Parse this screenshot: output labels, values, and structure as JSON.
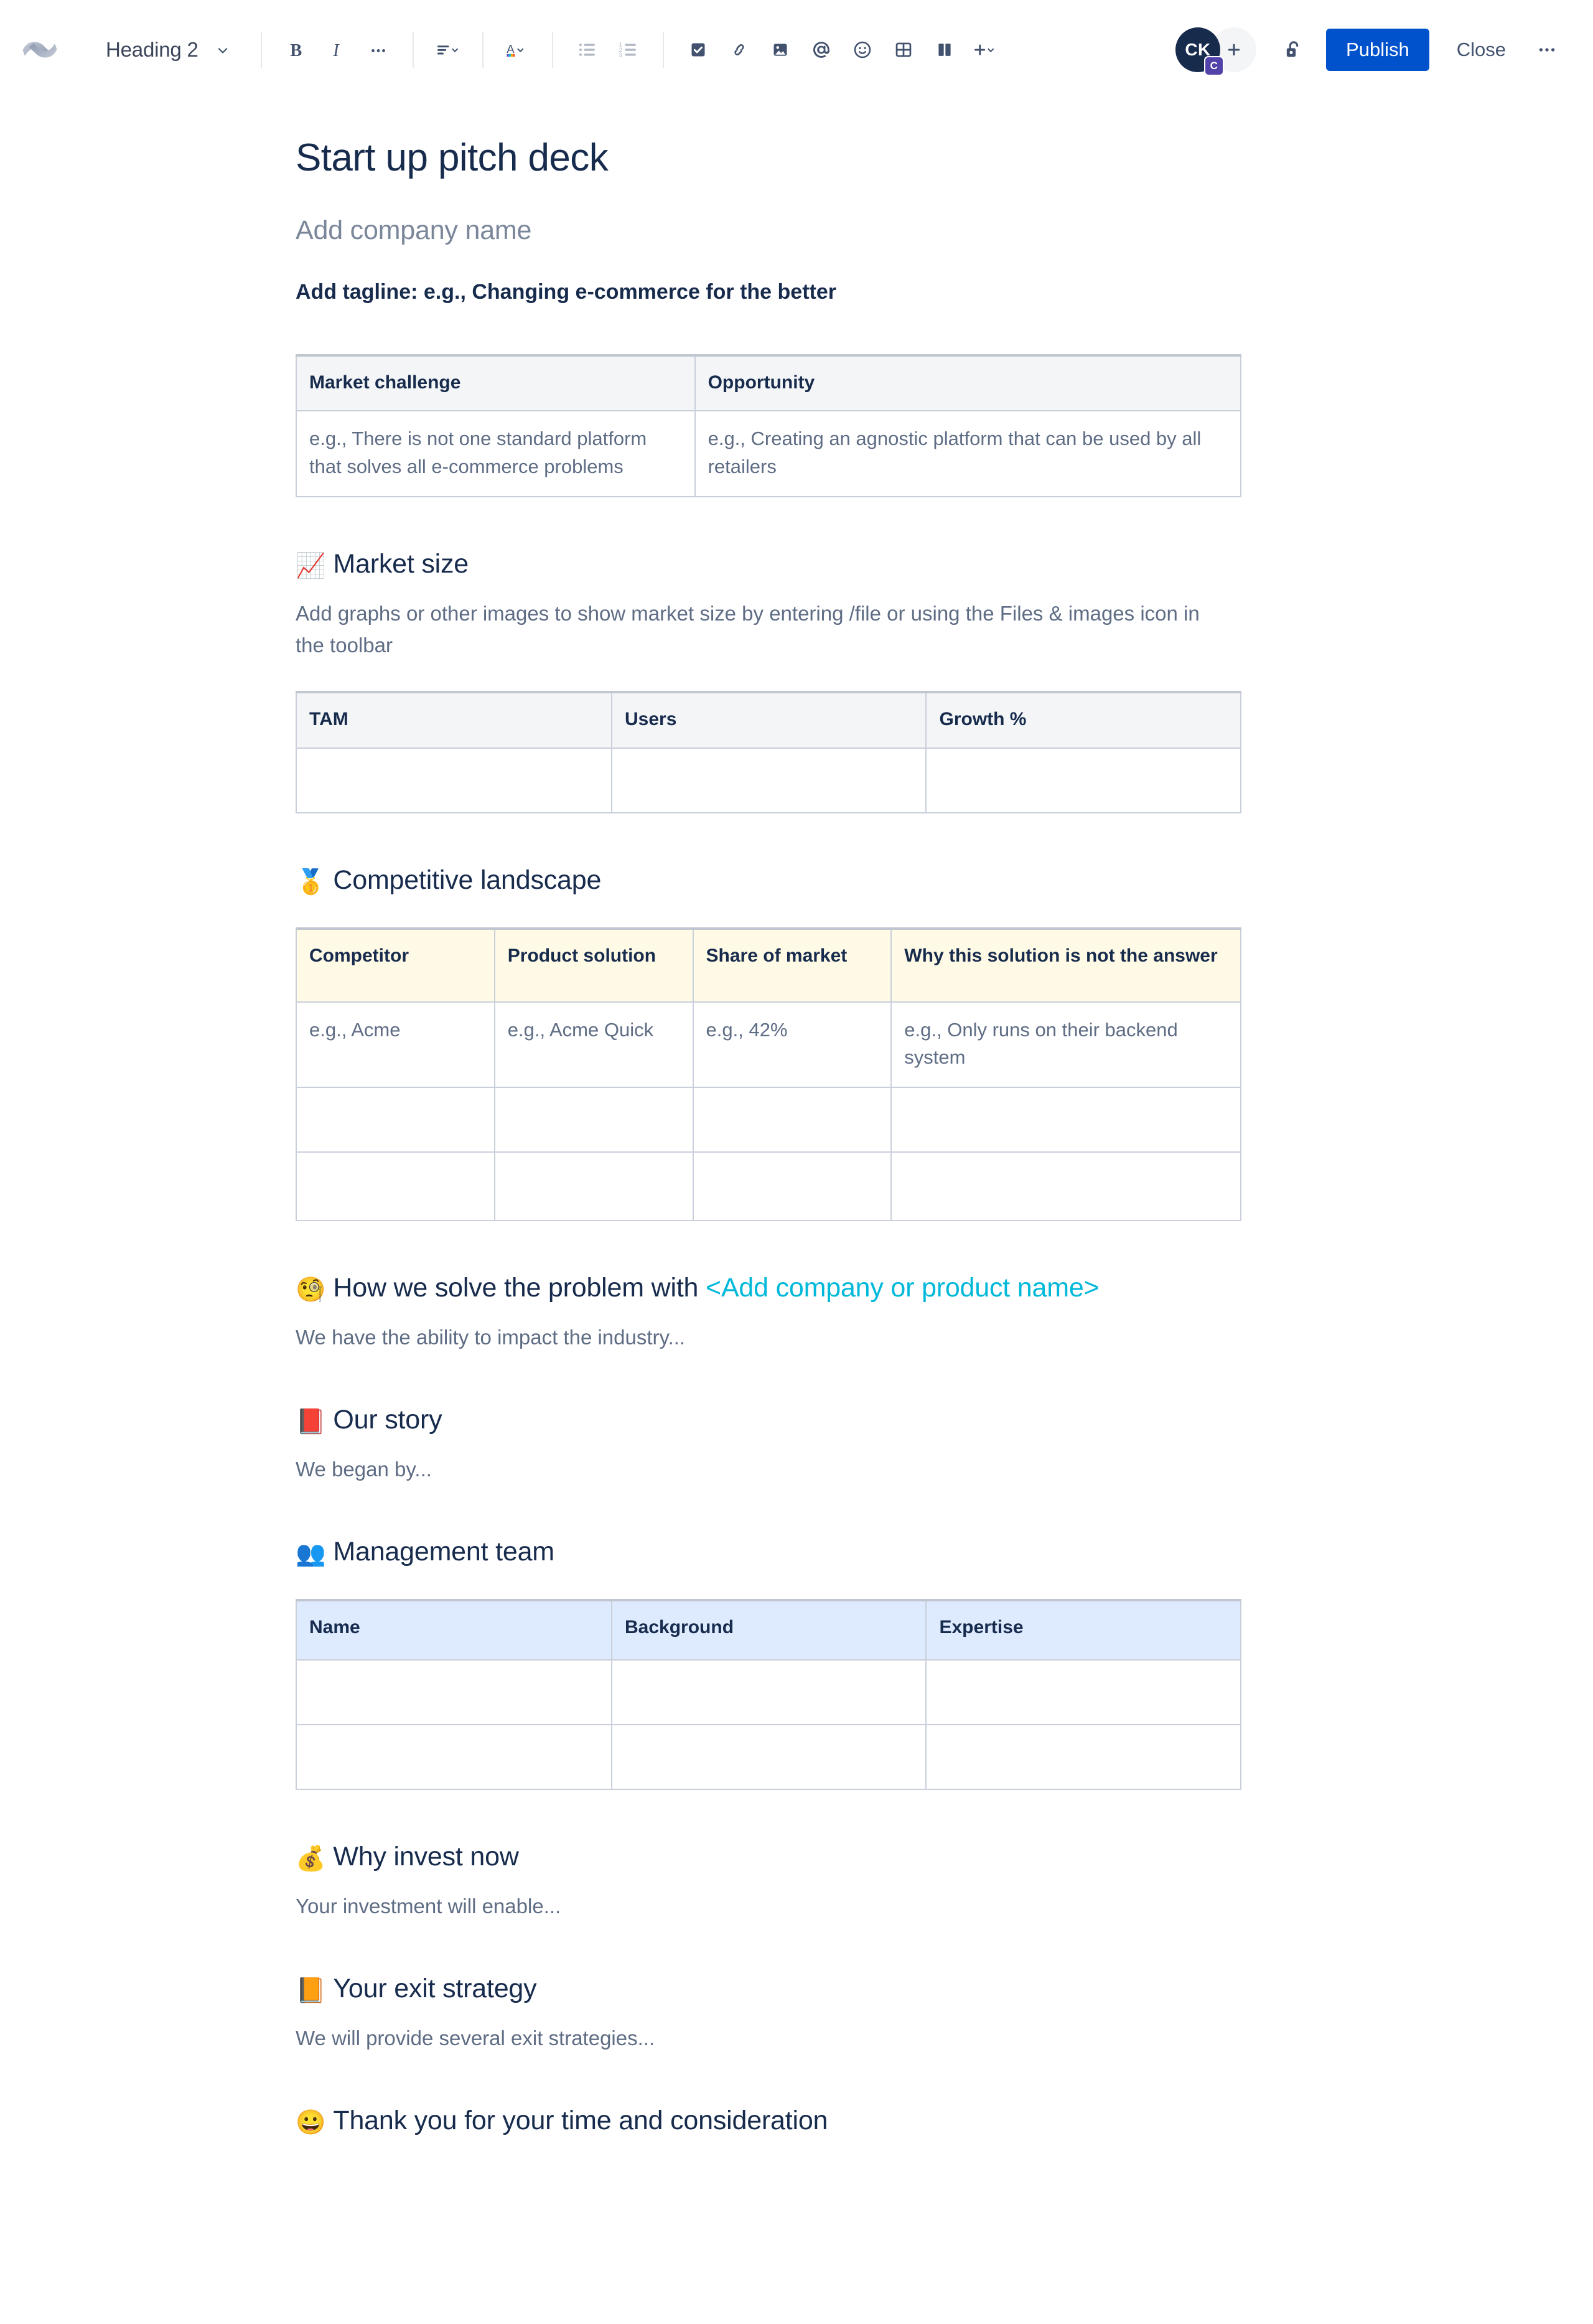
{
  "toolbar": {
    "logo_name": "confluence-logo",
    "style_dropdown": {
      "value": "Heading 2"
    },
    "buttons": [
      {
        "name": "bold-button",
        "label": "B"
      },
      {
        "name": "italic-button",
        "label": "I"
      },
      {
        "name": "more-formatting-button",
        "label": "..."
      },
      {
        "name": "text-alignment-button",
        "label": "Align"
      },
      {
        "name": "text-color-button",
        "label": "A"
      },
      {
        "name": "bullet-list-button",
        "label": "Bullet list"
      },
      {
        "name": "numbered-list-button",
        "label": "Numbered list"
      },
      {
        "name": "action-item-button",
        "label": "Action item"
      },
      {
        "name": "link-button",
        "label": "Link"
      },
      {
        "name": "files-and-images-button",
        "label": "Files & images"
      },
      {
        "name": "mention-button",
        "label": "Mention"
      },
      {
        "name": "emoji-button",
        "label": "Emoji"
      },
      {
        "name": "table-button",
        "label": "Table"
      },
      {
        "name": "layout-button",
        "label": "Layout"
      },
      {
        "name": "insert-more-button",
        "label": "Insert more"
      }
    ],
    "avatar": {
      "initials": "CK",
      "badge": "C"
    },
    "invite_label": "+",
    "restrictions_label": "Restrictions",
    "publish_label": "Publish",
    "close_label": "Close",
    "more_label": "•••"
  },
  "document": {
    "title": "Start up pitch deck",
    "company_name_placeholder": "Add company name",
    "tagline": "Add tagline: e.g., Changing e-commerce for the better",
    "challenge_table": {
      "headers": [
        "Market challenge",
        "Opportunity"
      ],
      "rows": [
        [
          "e.g., There is not one standard platform that solves all e-commerce problems",
          "e.g., Creating an agnostic platform that can be used by all retailers"
        ]
      ]
    },
    "sections": [
      {
        "id": "market-size",
        "emoji": "📈",
        "emoji_name": "chart-increasing-icon",
        "heading": "Market size",
        "body": "Add graphs or other images to show market size by entering /file or using the Files & images icon in the toolbar"
      },
      {
        "id": "competitive-landscape",
        "emoji": "🥇",
        "emoji_name": "medal-icon",
        "heading": "Competitive landscape",
        "body": ""
      },
      {
        "id": "how-we-solve",
        "emoji": "🧐",
        "emoji_name": "face-with-monocle-icon",
        "heading": "How we solve the problem with ",
        "heading_highlight": "<Add company or product name>",
        "highlight_color": "#00b8d9",
        "body": "We have the ability to impact the industry..."
      },
      {
        "id": "our-story",
        "emoji": "📕",
        "emoji_name": "closed-book-icon",
        "heading": "Our story",
        "body": "We began by..."
      },
      {
        "id": "management-team",
        "emoji": "👥",
        "emoji_name": "busts-in-silhouette-icon",
        "heading": "Management team",
        "body": ""
      },
      {
        "id": "why-invest-now",
        "emoji": "💰",
        "emoji_name": "money-bag-icon",
        "heading": "Why invest now",
        "body": "Your investment will enable..."
      },
      {
        "id": "exit-strategy",
        "emoji": "📙",
        "emoji_name": "orange-book-icon",
        "heading": "Your exit strategy",
        "body": "We will provide several exit strategies..."
      },
      {
        "id": "thank-you",
        "emoji": "😀",
        "emoji_name": "grinning-face-icon",
        "heading": "Thank you for your time and consideration",
        "body": ""
      }
    ],
    "market_size_table": {
      "headers": [
        "TAM",
        "Users",
        "Growth %"
      ],
      "rows": [
        [
          "",
          "",
          ""
        ]
      ]
    },
    "competitive_table": {
      "headers": [
        "Competitor",
        "Product solution",
        "Share of market",
        "Why this solution is not the answer"
      ],
      "rows": [
        [
          "e.g., Acme",
          "e.g., Acme Quick",
          "e.g., 42%",
          "e.g., Only runs on their backend system"
        ],
        [
          "",
          "",
          "",
          ""
        ],
        [
          "",
          "",
          "",
          ""
        ]
      ]
    },
    "management_table": {
      "headers": [
        "Name",
        "Background",
        "Expertise"
      ],
      "rows": [
        [
          "",
          "",
          ""
        ],
        [
          "",
          "",
          ""
        ]
      ]
    }
  },
  "colors": {
    "brand_blue": "#0052cc",
    "text_dark": "#172b4d",
    "text_muted": "#5e6c84",
    "placeholder_heading": "#7a8699",
    "cyan_accent": "#00b8d9",
    "header_gray": "#f4f5f7",
    "header_cream": "#fffae6",
    "header_blue": "#deebff",
    "border": "#c9cfdb"
  }
}
